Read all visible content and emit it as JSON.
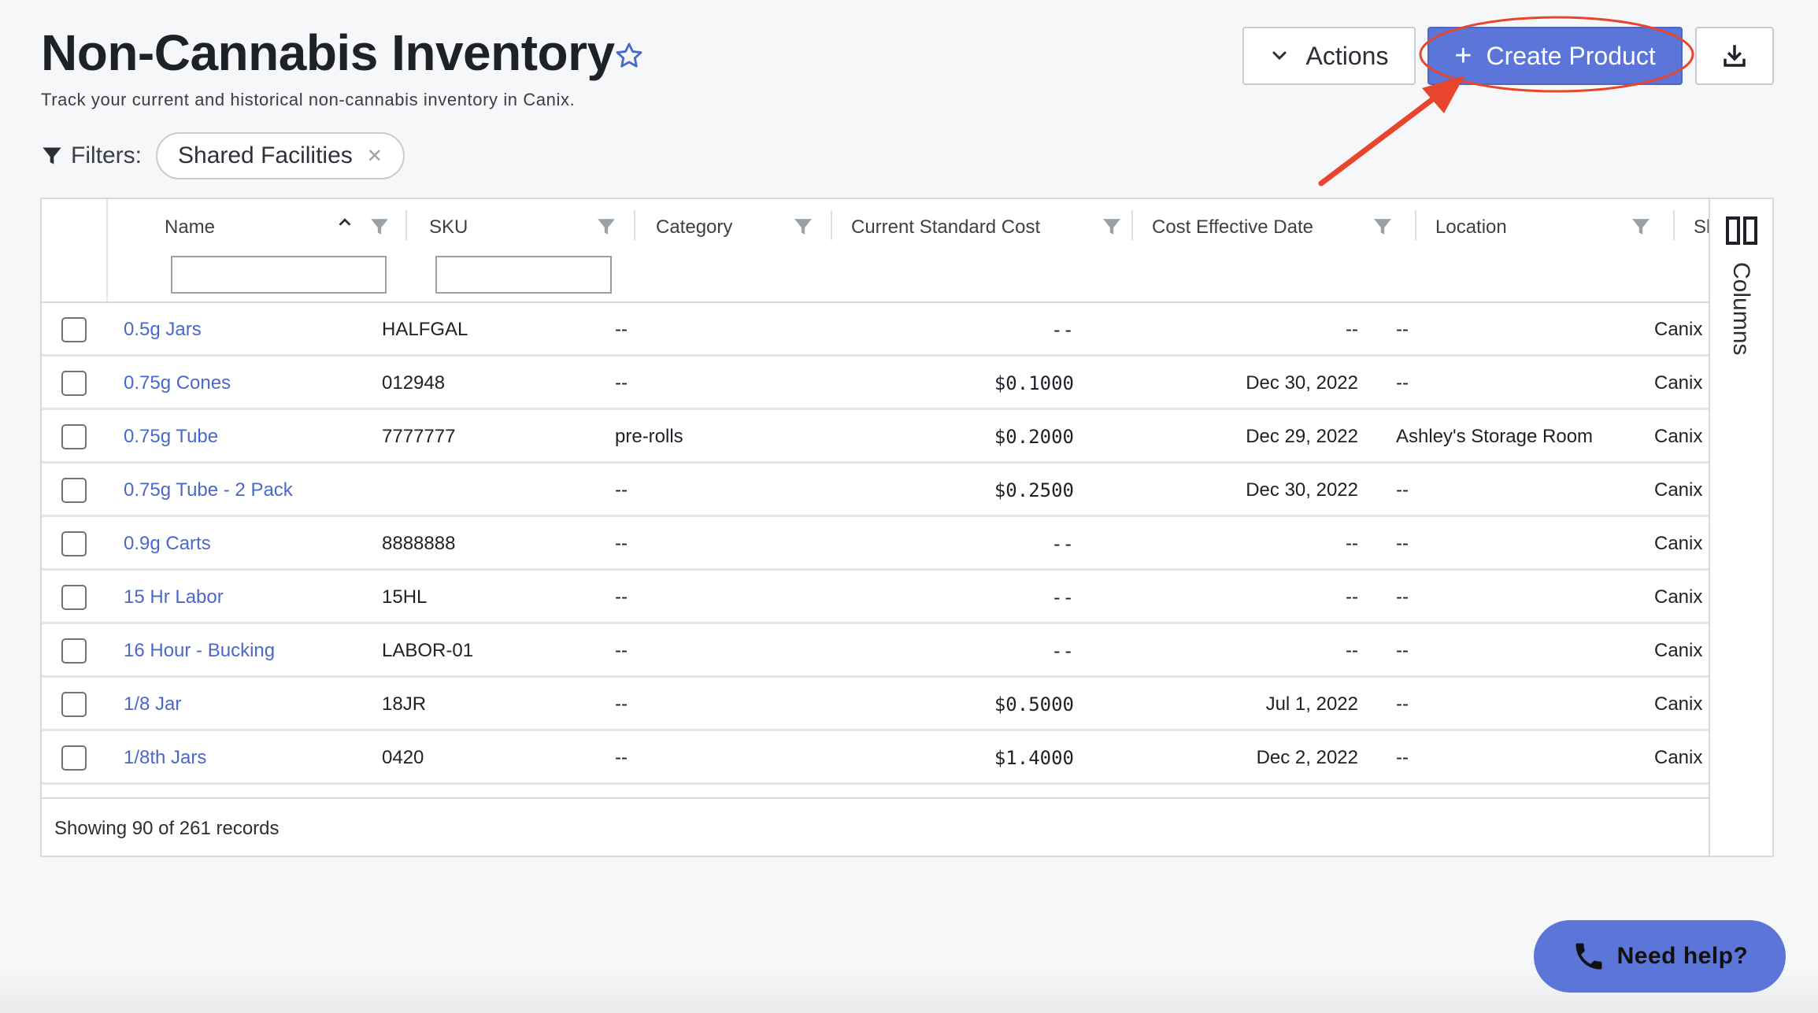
{
  "page": {
    "title": "Non-Cannabis Inventory",
    "subtitle": "Track your current and historical non-cannabis inventory in Canix.",
    "filters_label": "Filters:",
    "filter_chip": "Shared Facilities"
  },
  "toolbar": {
    "actions_label": "Actions",
    "create_label": "Create Product"
  },
  "table": {
    "headers": {
      "name": "Name",
      "sku": "SKU",
      "category": "Category",
      "cost": "Current Standard Cost",
      "date": "Cost Effective Date",
      "location": "Location",
      "shared": "Shared"
    },
    "rows": [
      {
        "name": "0.5g Jars",
        "sku": "HALFGAL",
        "category": "--",
        "cost": "--",
        "date": "--",
        "location": "--",
        "shared": "Canix C"
      },
      {
        "name": "0.75g Cones",
        "sku": "012948",
        "category": "--",
        "cost": "$0.1000",
        "date": "Dec 30, 2022",
        "location": "--",
        "shared": "Canix C"
      },
      {
        "name": "0.75g Tube",
        "sku": "7777777",
        "category": "pre-rolls",
        "cost": "$0.2000",
        "date": "Dec 29, 2022",
        "location": "Ashley's Storage Room",
        "shared": "Canix C"
      },
      {
        "name": "0.75g Tube - 2 Pack",
        "sku": "",
        "category": "--",
        "cost": "$0.2500",
        "date": "Dec 30, 2022",
        "location": "--",
        "shared": "Canix C"
      },
      {
        "name": "0.9g Carts",
        "sku": "8888888",
        "category": "--",
        "cost": "--",
        "date": "--",
        "location": "--",
        "shared": "Canix C"
      },
      {
        "name": "15 Hr Labor",
        "sku": "15HL",
        "category": "--",
        "cost": "--",
        "date": "--",
        "location": "--",
        "shared": "Canix C"
      },
      {
        "name": "16 Hour - Bucking",
        "sku": "LABOR-01",
        "category": "--",
        "cost": "--",
        "date": "--",
        "location": "--",
        "shared": "Canix C"
      },
      {
        "name": "1/8 Jar",
        "sku": "18JR",
        "category": "--",
        "cost": "$0.5000",
        "date": "Jul 1, 2022",
        "location": "--",
        "shared": "Canix C"
      },
      {
        "name": "1/8th Jars",
        "sku": "0420",
        "category": "--",
        "cost": "$1.4000",
        "date": "Dec 2, 2022",
        "location": "--",
        "shared": "Canix C"
      }
    ],
    "footer": "Showing 90 of 261 records",
    "columns_panel": "Columns"
  },
  "help": {
    "label": "Need help?"
  },
  "colors": {
    "primary": "#5b75d8",
    "link": "#4a68c9",
    "annotation": "#e8452c"
  },
  "icons": [
    "star-icon",
    "filter-icon",
    "chevron-down-icon",
    "plus-icon",
    "download-icon",
    "sort-up-icon",
    "column-filter-icon",
    "columns-icon",
    "phone-icon"
  ]
}
